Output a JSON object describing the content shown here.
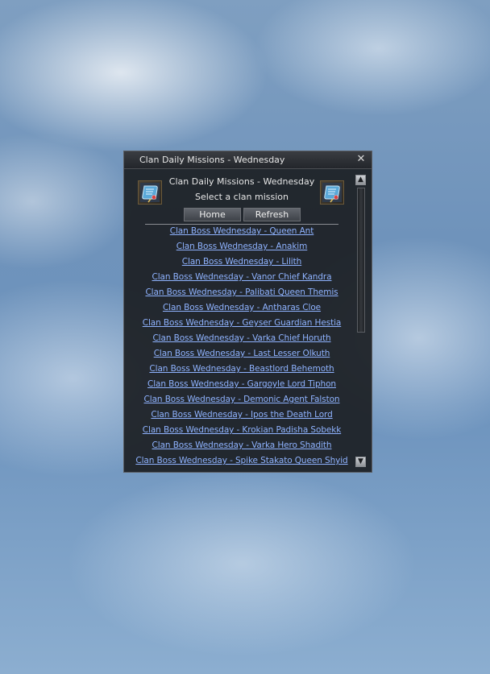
{
  "window": {
    "title": "Clan Daily Missions - Wednesday",
    "close_symbol": "✕"
  },
  "header": {
    "line1": "Clan Daily Missions - Wednesday",
    "line2": "Select a clan mission"
  },
  "buttons": {
    "home": "Home",
    "refresh": "Refresh"
  },
  "missions": [
    "Clan Boss Wednesday - Queen Ant",
    "Clan Boss Wednesday - Anakim",
    "Clan Boss Wednesday - Lilith",
    "Clan Boss Wednesday - Vanor Chief Kandra",
    "Clan Boss Wednesday - Palibati Queen Themis",
    "Clan Boss Wednesday - Antharas Cloe",
    "Clan Boss Wednesday - Geyser Guardian Hestia",
    "Clan Boss Wednesday - Varka Chief Horuth",
    "Clan Boss Wednesday - Last Lesser Olkuth",
    "Clan Boss Wednesday - Beastlord Behemoth",
    "Clan Boss Wednesday - Gargoyle Lord Tiphon",
    "Clan Boss Wednesday - Demonic Agent Falston",
    "Clan Boss Wednesday - Ipos the Death Lord",
    "Clan Boss Wednesday - Krokian Padisha Sobekk",
    "Clan Boss Wednesday - Varka Hero Shadith",
    "Clan Boss Wednesday - Spike Stakato Queen Shyid"
  ],
  "icons": {
    "left": "quest-scroll-icon",
    "right": "quest-scroll-icon",
    "scroll_up": "arrow-up-icon",
    "scroll_down": "arrow-down-icon"
  },
  "colors": {
    "link": "#8fb3ff",
    "panel_bg": "#1c1f24"
  }
}
